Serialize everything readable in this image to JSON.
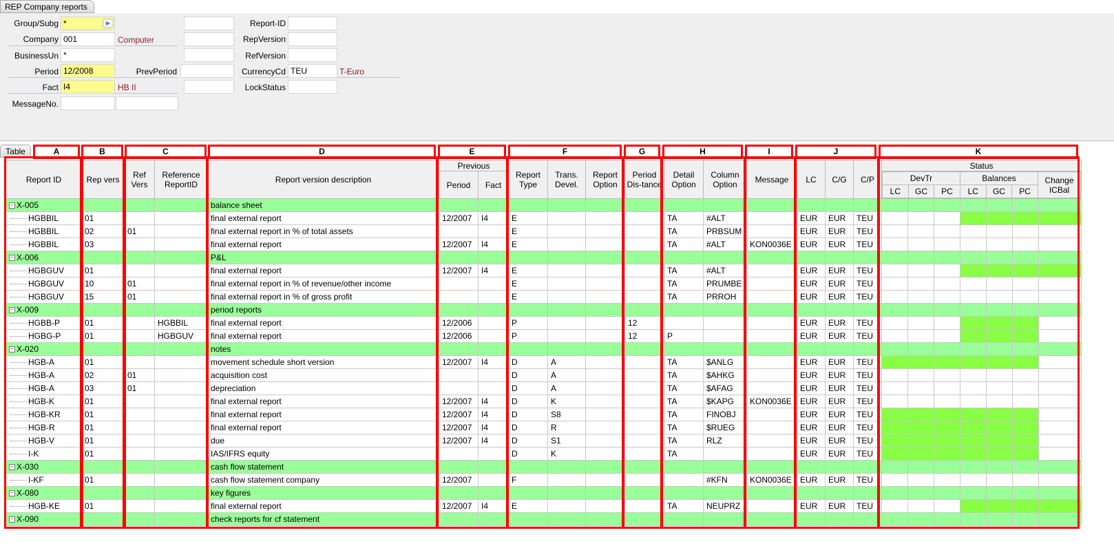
{
  "window": {
    "title": "REP Company reports"
  },
  "form": {
    "group_label": "Group/Subg",
    "group_value": "*",
    "company_label": "Company",
    "company_value": "001",
    "company_desc": "Computer",
    "bu_label": "BusinessUn",
    "bu_value": "*",
    "period_label": "Period",
    "period_value": "12/2008",
    "prevperiod_label": "PrevPeriod",
    "fact_label": "Fact",
    "fact_value": "I4",
    "fact_desc": "HB II",
    "msg_label": "MessageNo.",
    "reportid_label": "Report-ID",
    "repversion_label": "RepVersion",
    "refversion_label": "RefVersion",
    "currency_label": "CurrencyCd",
    "currency_value": "TEU",
    "currency_desc": "T-Euro",
    "lockstatus_label": "LockStatus"
  },
  "tabs": {
    "table": "Table"
  },
  "column_groups": [
    "A",
    "B",
    "C",
    "D",
    "E",
    "F",
    "G",
    "H",
    "I",
    "J",
    "K"
  ],
  "headers": {
    "report_id": "Report ID",
    "rep_vers": "Rep vers",
    "ref_vers": "Ref Vers",
    "reference_report_id": "Reference ReportID",
    "description": "Report version description",
    "previous": "Previous",
    "period": "Period",
    "fact": "Fact",
    "report_type": "Report Type",
    "trans_devel": "Trans. Devel.",
    "report_option": "Report Option",
    "period_distance": "Period Dis-tance",
    "detail_option": "Detail Option",
    "column_option": "Column Option",
    "message": "Message",
    "lc": "LC",
    "cg": "C/G",
    "cp": "C/P",
    "status": "Status",
    "devtr": "DevTr",
    "balances": "Balances",
    "change_icbal": "Change ICBal",
    "s_lc": "LC",
    "s_gc": "GC",
    "s_pc": "PC"
  },
  "rows": [
    {
      "group": true,
      "id": "X-005",
      "desc": "balance sheet"
    },
    {
      "id": "HGBBIL",
      "rv": "01",
      "refv": "",
      "refid": "",
      "desc": "final external report",
      "per": "12/2007",
      "fact": "I4",
      "type": "E",
      "trans": "",
      "ropt": "",
      "dist": "",
      "det": "TA",
      "col": "#ALT",
      "msg": "",
      "lc": "EUR",
      "cg": "EUR",
      "cp": "TEU",
      "green": [
        3,
        4,
        5,
        6
      ]
    },
    {
      "id": "HGBBIL",
      "rv": "02",
      "refv": "01",
      "refid": "",
      "desc": "final external report in % of total assets",
      "per": "",
      "fact": "",
      "type": "E",
      "trans": "",
      "ropt": "",
      "dist": "",
      "det": "TA",
      "col": "PRBSUM",
      "msg": "",
      "lc": "EUR",
      "cg": "EUR",
      "cp": "TEU",
      "green": []
    },
    {
      "id": "HGBBIL",
      "rv": "03",
      "refv": "",
      "refid": "",
      "desc": "final external report",
      "per": "12/2007",
      "fact": "I4",
      "type": "E",
      "trans": "",
      "ropt": "",
      "dist": "",
      "det": "TA",
      "col": "#ALT",
      "msg": "KON0036E",
      "lc": "EUR",
      "cg": "EUR",
      "cp": "TEU",
      "green": []
    },
    {
      "group": true,
      "id": "X-006",
      "desc": "P&L"
    },
    {
      "id": "HGBGUV",
      "rv": "01",
      "refv": "",
      "refid": "",
      "desc": "final external report",
      "per": "12/2007",
      "fact": "I4",
      "type": "E",
      "trans": "",
      "ropt": "",
      "dist": "",
      "det": "TA",
      "col": "#ALT",
      "msg": "",
      "lc": "EUR",
      "cg": "EUR",
      "cp": "TEU",
      "green": [
        3,
        4,
        5,
        6
      ]
    },
    {
      "id": "HGBGUV",
      "rv": "10",
      "refv": "01",
      "refid": "",
      "desc": "final external report in % of revenue/other income",
      "per": "",
      "fact": "",
      "type": "E",
      "trans": "",
      "ropt": "",
      "dist": "",
      "det": "TA",
      "col": "PRUMBE",
      "msg": "",
      "lc": "EUR",
      "cg": "EUR",
      "cp": "TEU",
      "green": []
    },
    {
      "id": "HGBGUV",
      "rv": "15",
      "refv": "01",
      "refid": "",
      "desc": "final external report in % of gross profit",
      "per": "",
      "fact": "",
      "type": "E",
      "trans": "",
      "ropt": "",
      "dist": "",
      "det": "TA",
      "col": "PRROH",
      "msg": "",
      "lc": "EUR",
      "cg": "EUR",
      "cp": "TEU",
      "green": []
    },
    {
      "group": true,
      "id": "X-009",
      "desc": "period reports"
    },
    {
      "id": "HGBB-P",
      "rv": "01",
      "refv": "",
      "refid": "HGBBIL",
      "desc": "final external report",
      "per": "12/2006",
      "fact": "",
      "type": "P",
      "trans": "",
      "ropt": "",
      "dist": "12",
      "det": "",
      "col": "",
      "msg": "",
      "lc": "EUR",
      "cg": "EUR",
      "cp": "TEU",
      "green": [
        3,
        4,
        5
      ]
    },
    {
      "id": "HGBG-P",
      "rv": "01",
      "refv": "",
      "refid": "HGBGUV",
      "desc": "final external report",
      "per": "12/2006",
      "fact": "",
      "type": "P",
      "trans": "",
      "ropt": "",
      "dist": "12",
      "det": "P",
      "col": "",
      "msg": "",
      "lc": "EUR",
      "cg": "EUR",
      "cp": "TEU",
      "green": [
        3,
        4,
        5
      ]
    },
    {
      "group": true,
      "id": "X-020",
      "desc": "notes"
    },
    {
      "id": "HGB-A",
      "rv": "01",
      "refv": "",
      "refid": "",
      "desc": "movement schedule short version",
      "per": "12/2007",
      "fact": "I4",
      "type": "D",
      "trans": "A",
      "ropt": "",
      "dist": "",
      "det": "TA",
      "col": "$ANLG",
      "msg": "",
      "lc": "EUR",
      "cg": "EUR",
      "cp": "TEU",
      "green": [
        0,
        1,
        2,
        3,
        4,
        5
      ]
    },
    {
      "id": "HGB-A",
      "rv": "02",
      "refv": "01",
      "refid": "",
      "desc": "acquisition cost",
      "per": "",
      "fact": "",
      "type": "D",
      "trans": "A",
      "ropt": "",
      "dist": "",
      "det": "TA",
      "col": "$AHKG",
      "msg": "",
      "lc": "EUR",
      "cg": "EUR",
      "cp": "TEU",
      "green": []
    },
    {
      "id": "HGB-A",
      "rv": "03",
      "refv": "01",
      "refid": "",
      "desc": "depreciation",
      "per": "",
      "fact": "",
      "type": "D",
      "trans": "A",
      "ropt": "",
      "dist": "",
      "det": "TA",
      "col": "$AFAG",
      "msg": "",
      "lc": "EUR",
      "cg": "EUR",
      "cp": "TEU",
      "green": []
    },
    {
      "id": "HGB-K",
      "rv": "01",
      "refv": "",
      "refid": "",
      "desc": "final external report",
      "per": "12/2007",
      "fact": "I4",
      "type": "D",
      "trans": "K",
      "ropt": "",
      "dist": "",
      "det": "TA",
      "col": "$KAPG",
      "msg": "KON0036E",
      "lc": "EUR",
      "cg": "EUR",
      "cp": "TEU",
      "green": []
    },
    {
      "id": "HGB-KR",
      "rv": "01",
      "refv": "",
      "refid": "",
      "desc": "final external report",
      "per": "12/2007",
      "fact": "I4",
      "type": "D",
      "trans": "S8",
      "ropt": "",
      "dist": "",
      "det": "TA",
      "col": "FINOBJ",
      "msg": "",
      "lc": "EUR",
      "cg": "EUR",
      "cp": "TEU",
      "green": [
        0,
        1,
        2,
        3,
        4,
        5
      ]
    },
    {
      "id": "HGB-R",
      "rv": "01",
      "refv": "",
      "refid": "",
      "desc": "final external report",
      "per": "12/2007",
      "fact": "I4",
      "type": "D",
      "trans": "R",
      "ropt": "",
      "dist": "",
      "det": "TA",
      "col": "$RUEG",
      "msg": "",
      "lc": "EUR",
      "cg": "EUR",
      "cp": "TEU",
      "green": [
        0,
        1,
        2,
        3,
        4,
        5
      ]
    },
    {
      "id": "HGB-V",
      "rv": "01",
      "refv": "",
      "refid": "",
      "desc": "due",
      "per": "12/2007",
      "fact": "I4",
      "type": "D",
      "trans": "S1",
      "ropt": "",
      "dist": "",
      "det": "TA",
      "col": "RLZ",
      "msg": "",
      "lc": "EUR",
      "cg": "EUR",
      "cp": "TEU",
      "green": [
        0,
        1,
        2,
        3,
        4,
        5
      ]
    },
    {
      "id": "I-K",
      "rv": "01",
      "refv": "",
      "refid": "",
      "desc": "IAS/IFRS equity",
      "per": "",
      "fact": "",
      "type": "D",
      "trans": "K",
      "ropt": "",
      "dist": "",
      "det": "TA",
      "col": "",
      "msg": "",
      "lc": "EUR",
      "cg": "EUR",
      "cp": "TEU",
      "green": [
        0,
        1,
        2,
        3,
        4,
        5
      ]
    },
    {
      "group": true,
      "id": "X-030",
      "desc": "cash flow statement"
    },
    {
      "id": "I-KF",
      "rv": "01",
      "refv": "",
      "refid": "",
      "desc": "cash flow statement company",
      "per": "12/2007",
      "fact": "",
      "type": "F",
      "trans": "",
      "ropt": "",
      "dist": "",
      "det": "",
      "col": "#KFN",
      "msg": "KON0036E",
      "lc": "EUR",
      "cg": "EUR",
      "cp": "TEU",
      "green": []
    },
    {
      "group": true,
      "id": "X-080",
      "desc": "key figures"
    },
    {
      "id": "HGB-KE",
      "rv": "01",
      "refv": "",
      "refid": "",
      "desc": "final external report",
      "per": "12/2007",
      "fact": "I4",
      "type": "E",
      "trans": "",
      "ropt": "",
      "dist": "",
      "det": "TA",
      "col": "NEUPRZ",
      "msg": "",
      "lc": "EUR",
      "cg": "EUR",
      "cp": "TEU",
      "green": [
        3,
        4,
        5,
        6
      ]
    },
    {
      "group": true,
      "id": "X-090",
      "desc": "check reports for cf statement"
    }
  ]
}
